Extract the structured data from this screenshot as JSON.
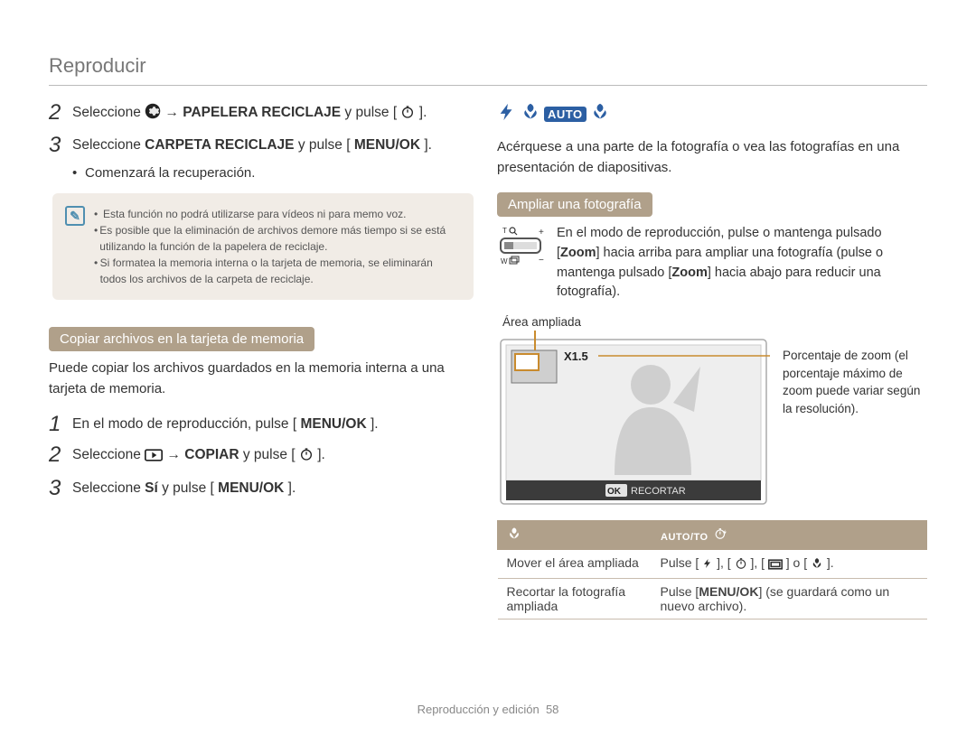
{
  "header": {
    "title": "Reproducir"
  },
  "left": {
    "step2": {
      "prefix": "Seleccione ",
      "arrow": " → ",
      "target": "PAPELERA RECICLAJE",
      "tail": " y pulse [",
      "tail2": "]."
    },
    "step3": {
      "prefix": "Seleccione ",
      "target": "CARPETA RECICLAJE",
      "tail": " y pulse [",
      "btn": "MENU/OK",
      "tail2": "]."
    },
    "step3_sub": "Comenzará la recuperación.",
    "note": {
      "mark": "✎",
      "items": [
        "Esta función no podrá utilizarse para vídeos ni para memo voz.",
        "Es posible que la eliminación de archivos demore más tiempo si se está utilizando la función de la papelera de reciclaje.",
        "Si formatea la memoria interna o la tarjeta de memoria, se eliminarán todos los archivos de la carpeta de reciclaje."
      ]
    },
    "heading_copy": "Copiar archivos en la tarjeta de memoria",
    "copy_intro": "Puede copiar los archivos guardados en la memoria interna a una tarjeta de memoria.",
    "copy_step1": {
      "txt_a": "En el modo de reproducción, pulse [",
      "btn": "MENU/OK",
      "txt_b": "]."
    },
    "copy_step2": {
      "prefix": "Seleccione ",
      "arrow": " → ",
      "target": "COPIAR",
      "tail": " y pulse [",
      "tail2": "]."
    },
    "copy_step3": {
      "prefix": "Seleccione ",
      "opt": "Sí",
      "tail": " y pulse [",
      "btn": "MENU/OK",
      "tail2": "]."
    }
  },
  "right": {
    "auto_label": "AUTO",
    "intro": "Acérquese a una parte de la fotografía o vea las fotografías en una presentación de diapositivas.",
    "heading_zoom": "Ampliar una fotografía",
    "zoom_text_a": "En el modo de reproducción, pulse o mantenga pulsado [",
    "zoom_word": "Zoom",
    "zoom_text_b": "] hacia arriba para ampliar una fotografía  (pulse o mantenga pulsado [",
    "zoom_text_c": "] hacia abajo para reducir una fotografía).",
    "area_label": "Área ampliada",
    "zoom_pct_desc": "Porcentaje de zoom (el porcentaje máximo de zoom puede variar según la resolución).",
    "preview_zoom": "X1.5",
    "preview_ok": "OK",
    "preview_crop": " RECORTAR",
    "table": {
      "row1": {
        "c1": "Mover el área ampliada",
        "c2_a": "Pulse [",
        "c2_sep": "], [",
        "c2_or": "] o [",
        "c2_end": "]."
      },
      "row2": {
        "c1": "Recortar la fotografía ampliada",
        "c2_a": "Pulse [",
        "c2_btn": "MENU/OK",
        "c2_b": "] (se guardará como un nuevo archivo)."
      }
    }
  },
  "footer": {
    "section": "Reproducción y edición",
    "page": "58"
  }
}
